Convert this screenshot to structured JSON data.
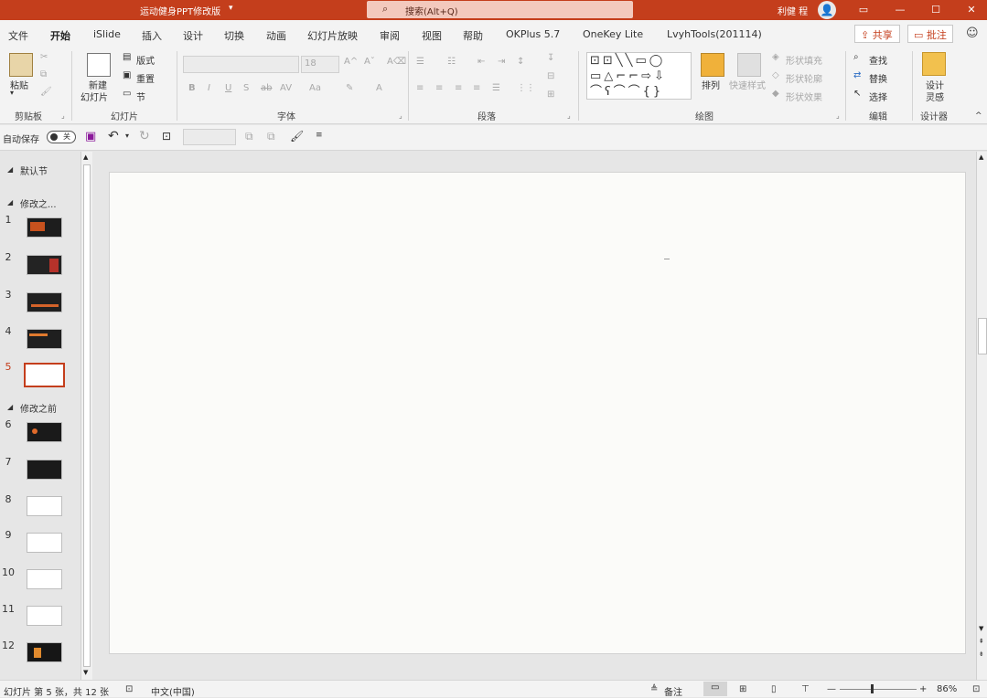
{
  "titlebar": {
    "title": "运动健身PPT修改版",
    "search_placeholder": "搜索(Alt+Q)",
    "user": "利健 程"
  },
  "tabs": [
    "文件",
    "开始",
    "iSlide",
    "插入",
    "设计",
    "切换",
    "动画",
    "幻灯片放映",
    "审阅",
    "视图",
    "帮助",
    "OKPlus 5.7",
    "OneKey Lite",
    "LvyhTools(201114)"
  ],
  "active_tab": "开始",
  "share_label": "共享",
  "comment_label": "批注",
  "ribbon": {
    "clipboard": {
      "paste": "粘贴",
      "group": "剪贴板"
    },
    "slides": {
      "new_line1": "新建",
      "new_line2": "幻灯片",
      "layout": "版式",
      "reset": "重置",
      "section": "节",
      "group": "幻灯片"
    },
    "font": {
      "size": "18",
      "group": "字体"
    },
    "paragraph": {
      "group": "段落"
    },
    "drawing": {
      "arrange": "排列",
      "quick_styles": "快速样式",
      "fill": "形状填充",
      "outline": "形状轮廓",
      "effects": "形状效果",
      "group": "绘图"
    },
    "editing": {
      "find": "查找",
      "replace": "替换",
      "select": "选择",
      "group": "编辑"
    },
    "designer": {
      "line1": "设计",
      "line2": "灵感",
      "group": "设计器"
    }
  },
  "qat": {
    "autosave": "自动保存",
    "autosave_state": "关"
  },
  "slides_pane": {
    "sections": [
      {
        "name": "默认节"
      },
      {
        "name": "修改之..."
      },
      {
        "name": "修改之前"
      }
    ],
    "numbers": [
      "1",
      "2",
      "3",
      "4",
      "5",
      "6",
      "7",
      "8",
      "9",
      "10",
      "11",
      "12"
    ],
    "selected": "5"
  },
  "status": {
    "slide_info": "幻灯片 第 5 张，共 12 张",
    "language": "中文(中国)",
    "notes": "备注",
    "zoom": "86%"
  },
  "colors": {
    "accent": "#c43e1c",
    "selected_thumb_border": "#c43e1c"
  }
}
